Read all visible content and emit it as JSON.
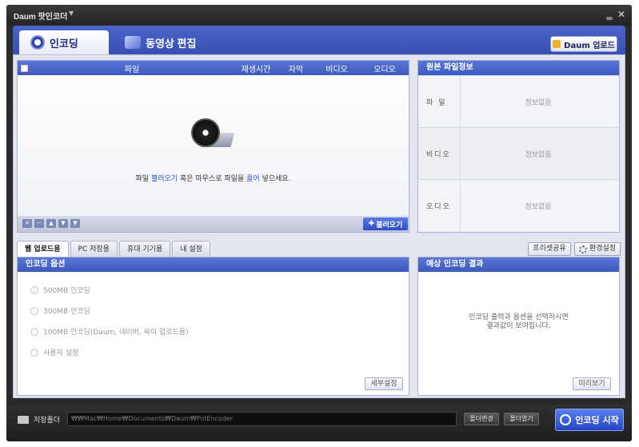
{
  "window": {
    "title": "Daum 팟인코더"
  },
  "tabs": [
    {
      "label": "인코딩"
    },
    {
      "label": "동영상 편집"
    }
  ],
  "upload_button": "Daum 업로드",
  "file_list": {
    "columns": [
      "파일",
      "재생시간",
      "자막",
      "비디오",
      "오디오"
    ],
    "hint_before": "파일 ",
    "hint_link1": "불러오기",
    "hint_middle": " 혹은 마우스로 파일을 ",
    "hint_link2": "끌어",
    "hint_after": " 넣으세요.",
    "open_button": "불러오기"
  },
  "original_info": {
    "title": "원본 파일정보",
    "rows": [
      {
        "label": "파 일",
        "value": "정보없음"
      },
      {
        "label": "비디오",
        "value": "정보없음"
      },
      {
        "label": "오디오",
        "value": "정보없음"
      }
    ]
  },
  "lower_tabs": [
    "웹 업로드용",
    "PC 저장용",
    "휴대 기기용",
    "내 설정"
  ],
  "preset_button": "프리셋공유",
  "settings_button": "환경설정",
  "options": {
    "title": "인코딩 옵션",
    "items": [
      "500MB 인코딩",
      "300MB 인코딩",
      "100MB 인코딩(Daum, 네이버, 싸이 업로드용)",
      "사용자 설정"
    ],
    "detail_button": "세부설정"
  },
  "result": {
    "title": "예상 인코딩 결과",
    "message_line1": "인코딩 출력과 옵션을 선택하시면",
    "message_line2": "결과값이 보여집니다.",
    "preview_button": "미리보기"
  },
  "bottom": {
    "save_label": "저장폴더",
    "path": "₩₩Mac₩Home₩Documents₩Daum₩PotEncoder",
    "change_button": "폴더변경",
    "open_button": "폴더열기",
    "start_button": "인코딩 시작"
  },
  "colors": {
    "accent": "#3e59bd",
    "link": "#2a4fd0",
    "title_bar": "#2a2a2a"
  }
}
